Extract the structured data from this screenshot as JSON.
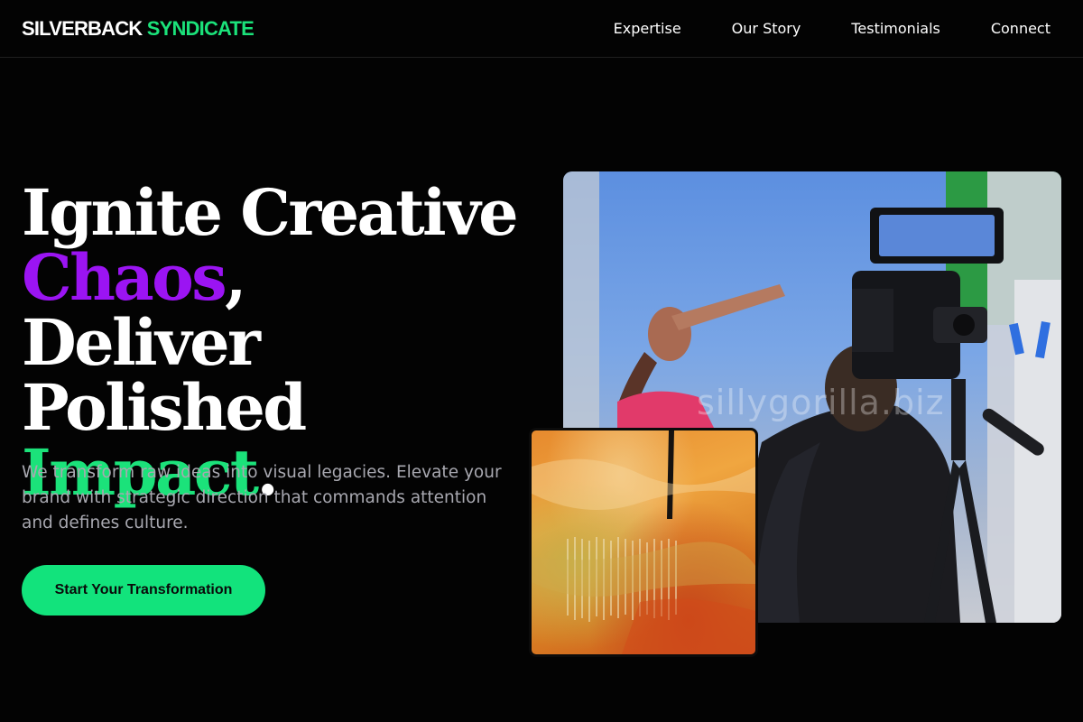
{
  "brand": {
    "part1": "SILVERBACK",
    "part2": "SYNDICATE"
  },
  "nav": {
    "items": [
      "Expertise",
      "Our Story",
      "Testimonials",
      "Connect"
    ]
  },
  "hero": {
    "line1": "Ignite Creative",
    "word_purple": "Chaos",
    "comma": ",",
    "line3": "Deliver Polished",
    "word_green": "Impact",
    "period": ".",
    "subtext": "We transform raw ideas into visual legacies. Elevate your brand with strategic direction that commands attention and defines culture.",
    "cta_label": "Start Your Transformation"
  },
  "images": {
    "main_watermark": "sillygorilla.biz"
  },
  "colors": {
    "background": "#030303",
    "accent_green": "#1be27a",
    "accent_purple": "#9b14f3",
    "cta_background": "#12e37c",
    "subtext": "#a8a8b0"
  }
}
